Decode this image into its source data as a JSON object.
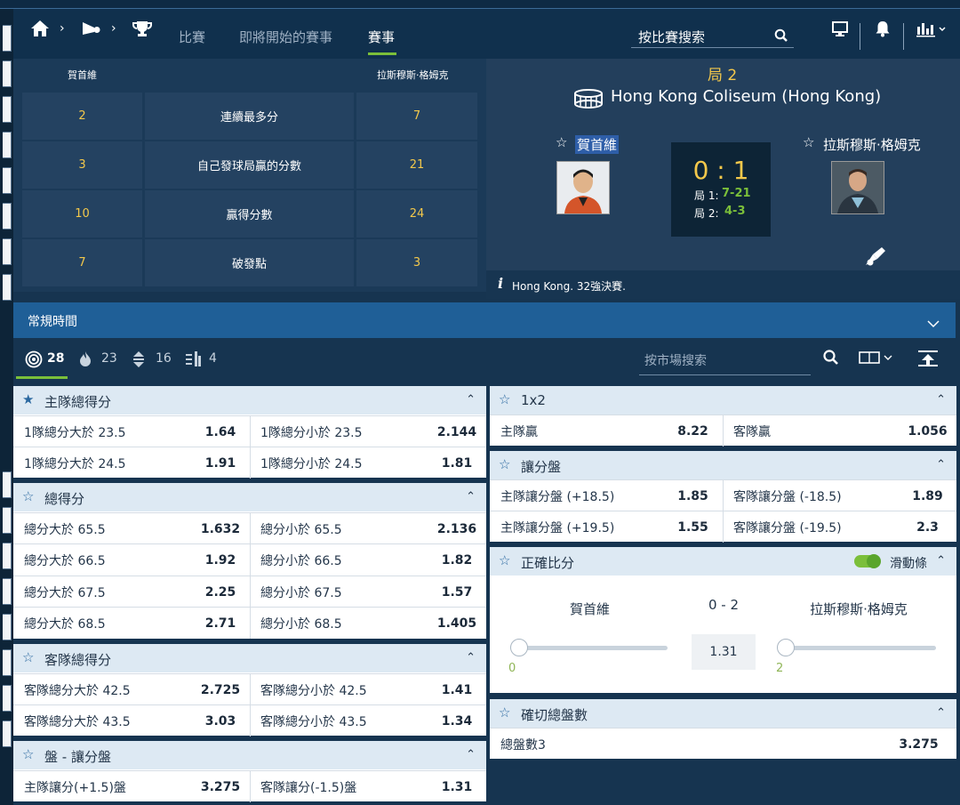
{
  "nav": {
    "links": [
      "比賽",
      "即將開始的賽事",
      "賽事"
    ],
    "search_label": "按比賽搜索"
  },
  "stats": {
    "home_name": "賀首維",
    "away_name": "拉斯穆斯·格姆克",
    "rows": [
      {
        "home": "2",
        "label": "連續最多分",
        "away": "7"
      },
      {
        "home": "3",
        "label": "自己發球局贏的分數",
        "away": "21"
      },
      {
        "home": "10",
        "label": "贏得分數",
        "away": "24"
      },
      {
        "home": "7",
        "label": "破發點",
        "away": "3"
      }
    ]
  },
  "match": {
    "set_label": "局 2",
    "venue": "Hong Kong Coliseum (Hong Kong)",
    "home_name": "賀首維",
    "away_name": "拉斯穆斯·格姆克",
    "score": "0 : 1",
    "sets": [
      {
        "label": "局 1:",
        "score": "7-21"
      },
      {
        "label": "局 2:",
        "score": "4-3"
      }
    ],
    "info": "Hong Kong. 32強決賽."
  },
  "section": {
    "title": "常規時間"
  },
  "filters": {
    "all": "28",
    "hot": "23",
    "updown": "16",
    "list": "4",
    "search_placeholder": "按市場搜索"
  },
  "left_markets": [
    {
      "title": "主隊總得分",
      "starred": true,
      "rows": [
        [
          "1隊總分大於 23.5",
          "1.64",
          "1隊總分小於 23.5",
          "2.144"
        ],
        [
          "1隊總分大於 24.5",
          "1.91",
          "1隊總分小於 24.5",
          "1.81"
        ]
      ]
    },
    {
      "title": "總得分",
      "starred": false,
      "rows": [
        [
          "總分大於 65.5",
          "1.632",
          "總分小於 65.5",
          "2.136"
        ],
        [
          "總分大於 66.5",
          "1.92",
          "總分小於 66.5",
          "1.82"
        ],
        [
          "總分大於 67.5",
          "2.25",
          "總分小於 67.5",
          "1.57"
        ],
        [
          "總分大於 68.5",
          "2.71",
          "總分小於 68.5",
          "1.405"
        ]
      ]
    },
    {
      "title": "客隊總得分",
      "starred": false,
      "rows": [
        [
          "客隊總分大於 42.5",
          "2.725",
          "客隊總分小於 42.5",
          "1.41"
        ],
        [
          "客隊總分大於 43.5",
          "3.03",
          "客隊總分小於 43.5",
          "1.34"
        ]
      ]
    },
    {
      "title": "盤 - 讓分盤",
      "starred": false,
      "rows": [
        [
          "主隊讓分(+1.5)盤",
          "3.275",
          "客隊讓分(-1.5)盤",
          "1.31"
        ]
      ]
    }
  ],
  "right_markets": {
    "x12": {
      "title": "1x2",
      "rows": [
        [
          "主隊贏",
          "8.22",
          "客隊贏",
          "1.056"
        ]
      ]
    },
    "handicap": {
      "title": "讓分盤",
      "rows": [
        [
          "主隊讓分盤 (+18.5)",
          "1.85",
          "客隊讓分盤 (-18.5)",
          "1.89"
        ],
        [
          "主隊讓分盤 (+19.5)",
          "1.55",
          "客隊讓分盤 (-19.5)",
          "2.3"
        ]
      ]
    },
    "correct_score": {
      "title": "正確比分",
      "toggle_label": "滑動條",
      "home_name": "賀首維",
      "away_name": "拉斯穆斯·格姆克",
      "score": "0 - 2",
      "odd": "1.31",
      "home_value": "0",
      "away_value": "2"
    },
    "exact_sets": {
      "title": "確切總盤數",
      "row_label": "總盤數3",
      "row_odd": "3.275"
    }
  },
  "colors": {
    "accent_green": "#7bbf3a",
    "gold": "#f3c84b",
    "section_blue": "#1f5f97"
  }
}
